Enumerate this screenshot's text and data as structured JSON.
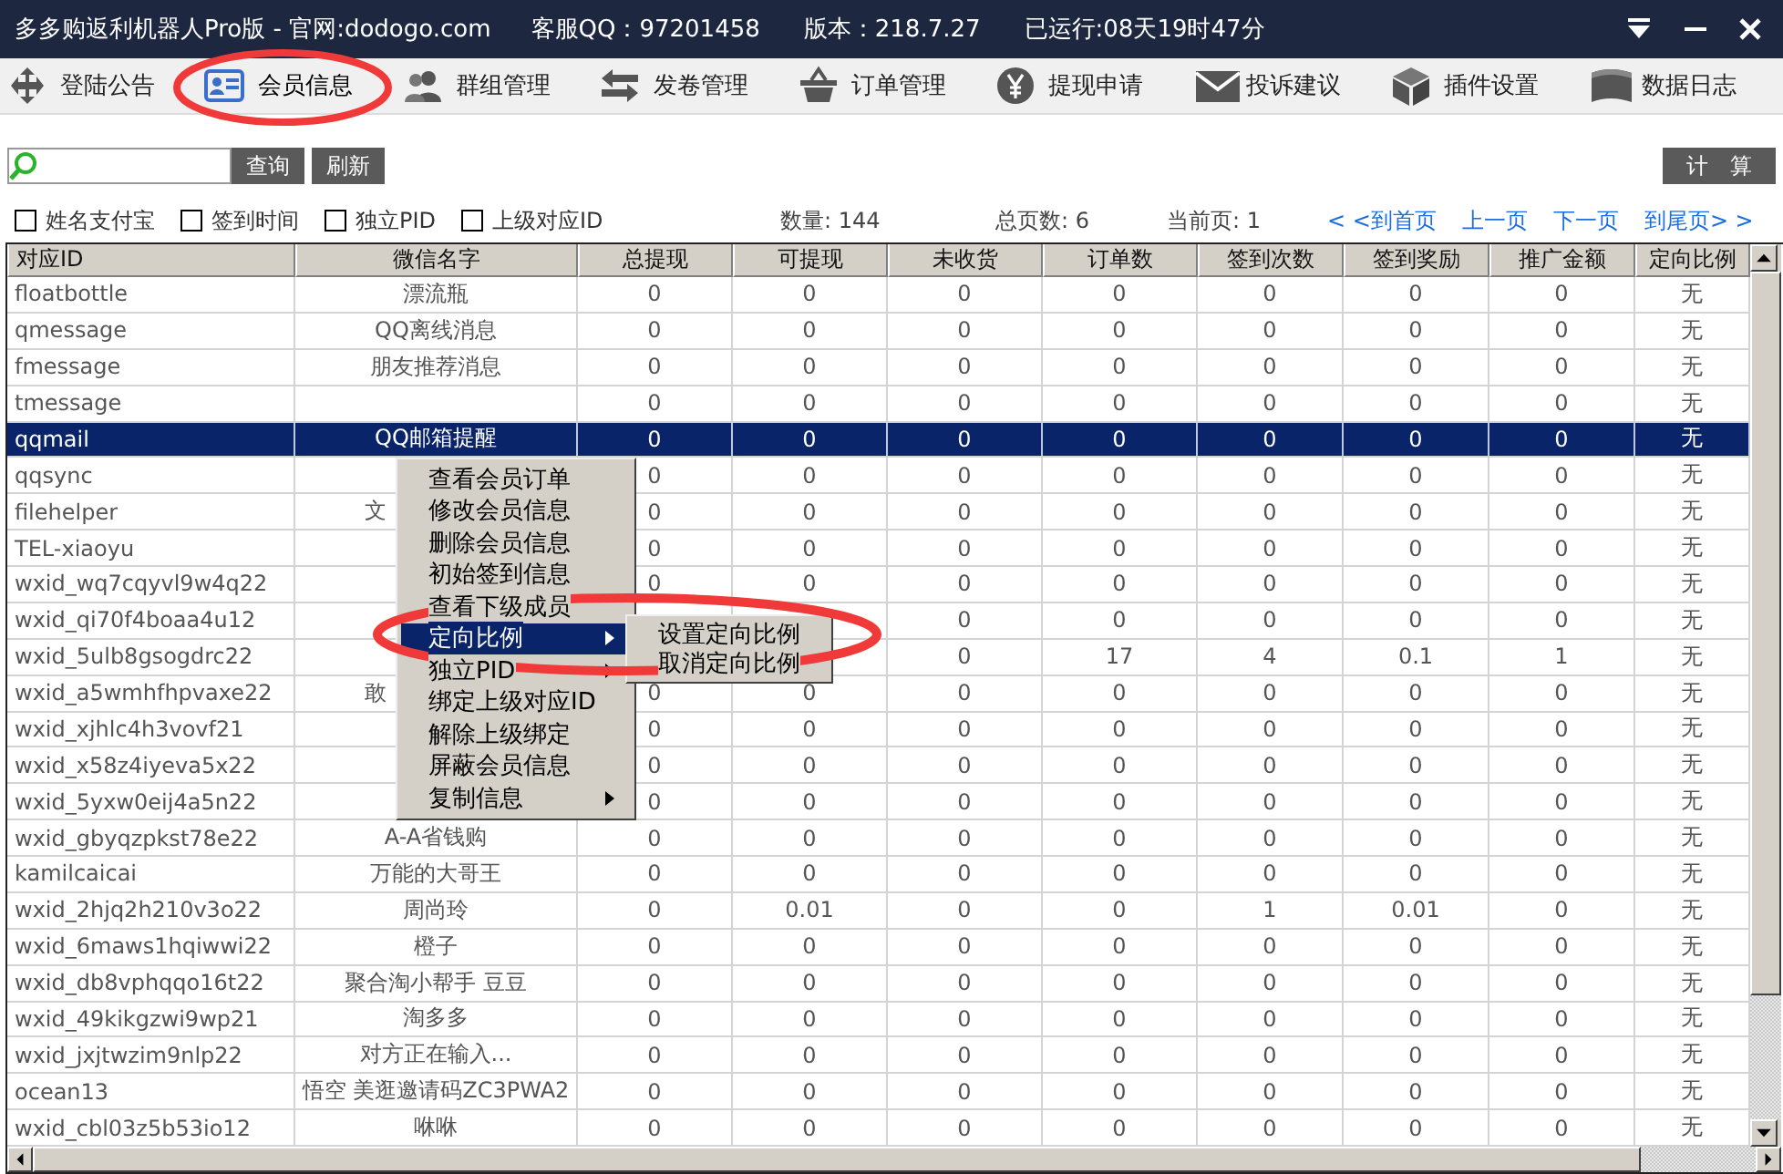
{
  "window": {
    "title": "多多购返利机器人Pro版 - 官网:dodogo.com",
    "service_qq": "客服QQ：97201458",
    "version": "版本：218.7.27",
    "uptime": "已运行:08天19时47分"
  },
  "toolbar": [
    {
      "label": "登陆公告",
      "selected": false
    },
    {
      "label": "会员信息",
      "selected": true
    },
    {
      "label": "群组管理",
      "selected": false
    },
    {
      "label": "发卷管理",
      "selected": false
    },
    {
      "label": "订单管理",
      "selected": false
    },
    {
      "label": "提现申请",
      "selected": false
    },
    {
      "label": "投诉建议",
      "selected": false
    },
    {
      "label": "插件设置",
      "selected": false
    },
    {
      "label": "数据日志",
      "selected": false
    }
  ],
  "search": {
    "button": "查询",
    "refresh": "刷新",
    "calc": "计　算"
  },
  "filters": [
    {
      "label": "姓名支付宝",
      "checked": false
    },
    {
      "label": "签到时间",
      "checked": false
    },
    {
      "label": "独立PID",
      "checked": false
    },
    {
      "label": "上级对应ID",
      "checked": false
    }
  ],
  "stats": [
    "数量: 144",
    "总页数: 6",
    "当前页: 1"
  ],
  "pager": [
    "< <到首页",
    "上一页",
    "下一页",
    "到尾页> >"
  ],
  "table": {
    "columns": [
      "对应ID",
      "微信名字",
      "总提现",
      "可提现",
      "未收货",
      "订单数",
      "签到次数",
      "签到奖励",
      "推广金额",
      "定向比例"
    ],
    "rows": [
      {
        "cells": [
          "floatbottle",
          "漂流瓶",
          "0",
          "0",
          "0",
          "0",
          "0",
          "0",
          "0",
          "无"
        ],
        "selected": false
      },
      {
        "cells": [
          "qmessage",
          "QQ离线消息",
          "0",
          "0",
          "0",
          "0",
          "0",
          "0",
          "0",
          "无"
        ],
        "selected": false
      },
      {
        "cells": [
          "fmessage",
          "朋友推荐消息",
          "0",
          "0",
          "0",
          "0",
          "0",
          "0",
          "0",
          "无"
        ],
        "selected": false
      },
      {
        "cells": [
          "tmessage",
          null,
          "0",
          "0",
          "0",
          "0",
          "0",
          "0",
          "0",
          "无"
        ],
        "selected": false
      },
      {
        "cells": [
          "qqmail",
          "QQ邮箱提醒",
          "0",
          "0",
          "0",
          "0",
          "0",
          "0",
          "0",
          "无"
        ],
        "selected": true
      },
      {
        "cells": [
          "qqsync",
          null,
          "0",
          "0",
          "0",
          "0",
          "0",
          "0",
          "0",
          "无"
        ],
        "selected": false
      },
      {
        "cells": [
          "filehelper",
          "文",
          "0",
          "0",
          "0",
          "0",
          "0",
          "0",
          "0",
          "无"
        ],
        "selected": false,
        "name_cut": true
      },
      {
        "cells": [
          "TEL-xiaoyu",
          null,
          "0",
          "0",
          "0",
          "0",
          "0",
          "0",
          "0",
          "无"
        ],
        "selected": false
      },
      {
        "cells": [
          "wxid_wq7cqyvl9w4q22",
          null,
          "0",
          "0",
          "0",
          "0",
          "0",
          "0",
          "0",
          "无"
        ],
        "selected": false
      },
      {
        "cells": [
          "wxid_qi70f4boaa4u12",
          null,
          null,
          null,
          "0",
          "0",
          "0",
          "0",
          "0",
          "无"
        ],
        "selected": false
      },
      {
        "cells": [
          "wxid_5ulb8gsogdrc22",
          null,
          null,
          null,
          "0",
          "17",
          "4",
          "0.1",
          "1",
          "无"
        ],
        "selected": false
      },
      {
        "cells": [
          "wxid_a5wmhfhpvaxe22",
          "敢",
          "0",
          "0",
          "0",
          "0",
          "0",
          "0",
          "0",
          "无"
        ],
        "selected": false,
        "name_cut": true
      },
      {
        "cells": [
          "wxid_xjhlc4h3vovf21",
          null,
          "0",
          "0",
          "0",
          "0",
          "0",
          "0",
          "0",
          "无"
        ],
        "selected": false
      },
      {
        "cells": [
          "wxid_x58z4iyeva5x22",
          null,
          "0",
          "0",
          "0",
          "0",
          "0",
          "0",
          "0",
          "无"
        ],
        "selected": false
      },
      {
        "cells": [
          "wxid_5yxw0eij4a5n22",
          null,
          "0",
          "0",
          "0",
          "0",
          "0",
          "0",
          "0",
          "无"
        ],
        "selected": false
      },
      {
        "cells": [
          "wxid_gbyqzpkst78e22",
          "A-A省钱购",
          "0",
          "0",
          "0",
          "0",
          "0",
          "0",
          "0",
          "无"
        ],
        "selected": false
      },
      {
        "cells": [
          "kamilcaicai",
          "万能的大哥王",
          "0",
          "0",
          "0",
          "0",
          "0",
          "0",
          "0",
          "无"
        ],
        "selected": false
      },
      {
        "cells": [
          "wxid_2hjq2h210v3o22",
          "周尚玲",
          "0",
          "0.01",
          "0",
          "0",
          "1",
          "0.01",
          "0",
          "无"
        ],
        "selected": false
      },
      {
        "cells": [
          "wxid_6maws1hqiwwi22",
          "橙子",
          "0",
          "0",
          "0",
          "0",
          "0",
          "0",
          "0",
          "无"
        ],
        "selected": false
      },
      {
        "cells": [
          "wxid_db8vphqqo16t22",
          "聚合淘小帮手 豆豆",
          "0",
          "0",
          "0",
          "0",
          "0",
          "0",
          "0",
          "无"
        ],
        "selected": false
      },
      {
        "cells": [
          "wxid_49kikgzwi9wp21",
          "淘多多",
          "0",
          "0",
          "0",
          "0",
          "0",
          "0",
          "0",
          "无"
        ],
        "selected": false
      },
      {
        "cells": [
          "wxid_jxjtwzim9nlp22",
          "对方正在输入...",
          "0",
          "0",
          "0",
          "0",
          "0",
          "0",
          "0",
          "无"
        ],
        "selected": false
      },
      {
        "cells": [
          "ocean13",
          "悟空 美逛邀请码ZC3PWA2",
          "0",
          "0",
          "0",
          "0",
          "0",
          "0",
          "0",
          "无"
        ],
        "selected": false
      },
      {
        "cells": [
          "wxid_cbl03z5b53io12",
          "咻咻",
          "0",
          "0",
          "0",
          "0",
          "0",
          "0",
          "0",
          "无"
        ],
        "selected": false
      }
    ]
  },
  "context_menu": {
    "items": [
      {
        "label": "查看会员订单",
        "selected": false,
        "has_submenu": false
      },
      {
        "label": "修改会员信息",
        "selected": false,
        "has_submenu": false
      },
      {
        "label": "删除会员信息",
        "selected": false,
        "has_submenu": false
      },
      {
        "label": "初始签到信息",
        "selected": false,
        "has_submenu": false
      },
      {
        "label": "查看下级成员",
        "selected": false,
        "has_submenu": false
      },
      {
        "label": "定向比例",
        "selected": true,
        "has_submenu": true
      },
      {
        "label": "独立PID",
        "selected": false,
        "has_submenu": true
      },
      {
        "label": "绑定上级对应ID",
        "selected": false,
        "has_submenu": false
      },
      {
        "label": "解除上级绑定",
        "selected": false,
        "has_submenu": false
      },
      {
        "label": "屏蔽会员信息",
        "selected": false,
        "has_submenu": false
      },
      {
        "label": "复制信息",
        "selected": false,
        "has_submenu": true
      }
    ],
    "submenu": [
      {
        "label": "设置定向比例",
        "selected": false
      },
      {
        "label": "取消定向比例",
        "selected": false
      }
    ]
  }
}
